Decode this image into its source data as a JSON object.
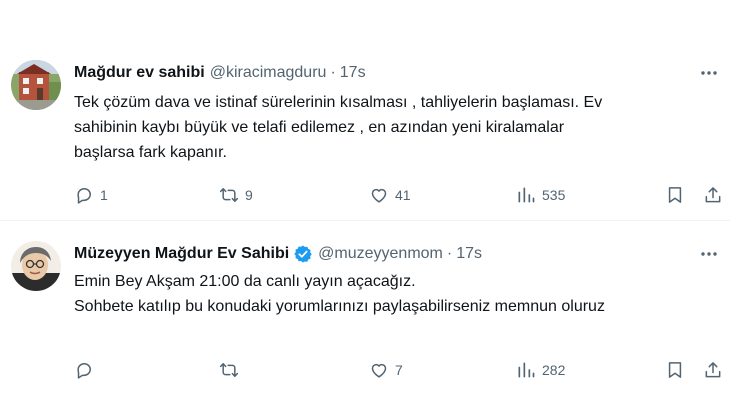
{
  "tweets": [
    {
      "name": "Mağdur ev sahibi",
      "handle": "@kiracimagduru",
      "dot": "·",
      "time": "17s",
      "verified": false,
      "text_lines": [
        "Tek çözüm dava ve istinaf sürelerinin kısalması , tahliyelerin başlaması. Ev",
        "sahibinin kaybı büyük ve telafi edilemez , en azından yeni kiralamalar",
        "başlarsa fark kapanır."
      ],
      "replies": "1",
      "reposts": "9",
      "likes": "41",
      "views": "535"
    },
    {
      "name": "Müzeyyen Mağdur Ev Sahibi",
      "handle": "@muzeyyenmom",
      "dot": "·",
      "time": "17s",
      "verified": true,
      "text_lines": [
        "Emin Bey Akşam 21:00 da canlı yayın açacağız.",
        "Sohbete katılıp bu konudaki yorumlarınızı paylaşabilirseniz memnun oluruz"
      ],
      "replies": "",
      "reposts": "",
      "likes": "7",
      "views": "282"
    }
  ],
  "colors": {
    "text": "#0f1419",
    "secondary": "#536471",
    "verified": "#1d9bf0",
    "divider": "#eff3f4"
  },
  "icons": {
    "more": "more-horizontal-icon",
    "reply": "reply-bubble-icon",
    "repost": "repost-arrows-icon",
    "like": "heart-icon",
    "views": "bar-chart-icon",
    "bookmark": "bookmark-icon",
    "share": "share-upload-icon",
    "verified": "verified-badge-icon"
  }
}
